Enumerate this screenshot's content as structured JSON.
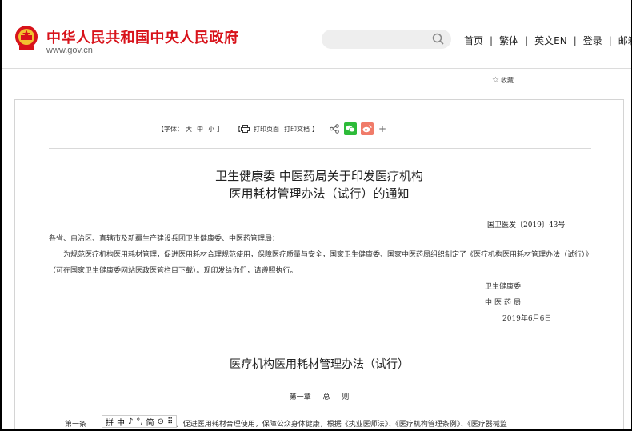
{
  "header": {
    "site_title": "中华人民共和国中央人民政府",
    "site_url": "www.gov.cn",
    "search_placeholder": "",
    "nav": [
      "首页",
      "繁体",
      "英文EN",
      "登录",
      "邮箱"
    ]
  },
  "favorite_label": "收藏",
  "toolbar": {
    "font_label": "【字体：",
    "font_large": "大",
    "font_medium": "中",
    "font_small": "小",
    "font_close": "】",
    "print_open": "【",
    "print_page": "打印页面",
    "print_doc": "打印文档",
    "print_close": "】",
    "plus": "+"
  },
  "document": {
    "title_line1": "卫生健康委 中医药局关于印发医疗机构",
    "title_line2": "医用耗材管理办法（试行）的通知",
    "number": "国卫医发〔2019〕43号",
    "salutation": "各省、自治区、直辖市及新疆生产建设兵团卫生健康委、中医药管理局：",
    "main_paragraph": "为规范医疗机构医用耗材管理，促进医用耗材合理规范使用，保障医疗质量与安全，国家卫生健康委、国家中医药局组织制定了《医疗机构医用耗材管理办法（试行）》（可在国家卫生健康委网站医政医管栏目下载）。现印发给你们，请遵照执行。",
    "signer1": "卫生健康委",
    "signer2": "中医药局",
    "date": "2019年6月6日",
    "sub_title": "医疗机构医用耗材管理办法（试行）",
    "chapter_num": "第一章",
    "chapter_name": "总",
    "chapter_name2": "则",
    "article_label": "第一条",
    "article_text": "耗材管理，促进医用耗材合理使用，保障公众身体健康，根据《执业医师法》、《医疗机构管理条例》、《医疗器械监"
  },
  "ime_toolbar": {
    "items": [
      "拼",
      "中",
      "♪",
      "°,",
      "简",
      "⊙",
      "⠿"
    ]
  }
}
